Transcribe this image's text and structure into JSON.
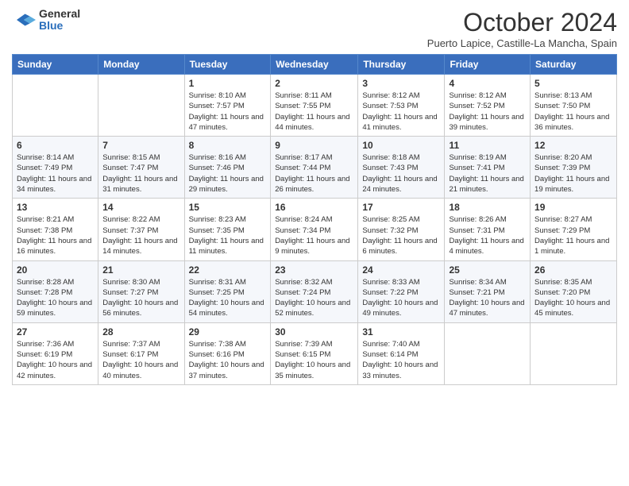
{
  "header": {
    "logo_line1": "General",
    "logo_line2": "Blue",
    "month_title": "October 2024",
    "subtitle": "Puerto Lapice, Castille-La Mancha, Spain"
  },
  "weekdays": [
    "Sunday",
    "Monday",
    "Tuesday",
    "Wednesday",
    "Thursday",
    "Friday",
    "Saturday"
  ],
  "weeks": [
    [
      {
        "day": "",
        "sunrise": "",
        "sunset": "",
        "daylight": ""
      },
      {
        "day": "",
        "sunrise": "",
        "sunset": "",
        "daylight": ""
      },
      {
        "day": "1",
        "sunrise": "Sunrise: 8:10 AM",
        "sunset": "Sunset: 7:57 PM",
        "daylight": "Daylight: 11 hours and 47 minutes."
      },
      {
        "day": "2",
        "sunrise": "Sunrise: 8:11 AM",
        "sunset": "Sunset: 7:55 PM",
        "daylight": "Daylight: 11 hours and 44 minutes."
      },
      {
        "day": "3",
        "sunrise": "Sunrise: 8:12 AM",
        "sunset": "Sunset: 7:53 PM",
        "daylight": "Daylight: 11 hours and 41 minutes."
      },
      {
        "day": "4",
        "sunrise": "Sunrise: 8:12 AM",
        "sunset": "Sunset: 7:52 PM",
        "daylight": "Daylight: 11 hours and 39 minutes."
      },
      {
        "day": "5",
        "sunrise": "Sunrise: 8:13 AM",
        "sunset": "Sunset: 7:50 PM",
        "daylight": "Daylight: 11 hours and 36 minutes."
      }
    ],
    [
      {
        "day": "6",
        "sunrise": "Sunrise: 8:14 AM",
        "sunset": "Sunset: 7:49 PM",
        "daylight": "Daylight: 11 hours and 34 minutes."
      },
      {
        "day": "7",
        "sunrise": "Sunrise: 8:15 AM",
        "sunset": "Sunset: 7:47 PM",
        "daylight": "Daylight: 11 hours and 31 minutes."
      },
      {
        "day": "8",
        "sunrise": "Sunrise: 8:16 AM",
        "sunset": "Sunset: 7:46 PM",
        "daylight": "Daylight: 11 hours and 29 minutes."
      },
      {
        "day": "9",
        "sunrise": "Sunrise: 8:17 AM",
        "sunset": "Sunset: 7:44 PM",
        "daylight": "Daylight: 11 hours and 26 minutes."
      },
      {
        "day": "10",
        "sunrise": "Sunrise: 8:18 AM",
        "sunset": "Sunset: 7:43 PM",
        "daylight": "Daylight: 11 hours and 24 minutes."
      },
      {
        "day": "11",
        "sunrise": "Sunrise: 8:19 AM",
        "sunset": "Sunset: 7:41 PM",
        "daylight": "Daylight: 11 hours and 21 minutes."
      },
      {
        "day": "12",
        "sunrise": "Sunrise: 8:20 AM",
        "sunset": "Sunset: 7:39 PM",
        "daylight": "Daylight: 11 hours and 19 minutes."
      }
    ],
    [
      {
        "day": "13",
        "sunrise": "Sunrise: 8:21 AM",
        "sunset": "Sunset: 7:38 PM",
        "daylight": "Daylight: 11 hours and 16 minutes."
      },
      {
        "day": "14",
        "sunrise": "Sunrise: 8:22 AM",
        "sunset": "Sunset: 7:37 PM",
        "daylight": "Daylight: 11 hours and 14 minutes."
      },
      {
        "day": "15",
        "sunrise": "Sunrise: 8:23 AM",
        "sunset": "Sunset: 7:35 PM",
        "daylight": "Daylight: 11 hours and 11 minutes."
      },
      {
        "day": "16",
        "sunrise": "Sunrise: 8:24 AM",
        "sunset": "Sunset: 7:34 PM",
        "daylight": "Daylight: 11 hours and 9 minutes."
      },
      {
        "day": "17",
        "sunrise": "Sunrise: 8:25 AM",
        "sunset": "Sunset: 7:32 PM",
        "daylight": "Daylight: 11 hours and 6 minutes."
      },
      {
        "day": "18",
        "sunrise": "Sunrise: 8:26 AM",
        "sunset": "Sunset: 7:31 PM",
        "daylight": "Daylight: 11 hours and 4 minutes."
      },
      {
        "day": "19",
        "sunrise": "Sunrise: 8:27 AM",
        "sunset": "Sunset: 7:29 PM",
        "daylight": "Daylight: 11 hours and 1 minute."
      }
    ],
    [
      {
        "day": "20",
        "sunrise": "Sunrise: 8:28 AM",
        "sunset": "Sunset: 7:28 PM",
        "daylight": "Daylight: 10 hours and 59 minutes."
      },
      {
        "day": "21",
        "sunrise": "Sunrise: 8:30 AM",
        "sunset": "Sunset: 7:27 PM",
        "daylight": "Daylight: 10 hours and 56 minutes."
      },
      {
        "day": "22",
        "sunrise": "Sunrise: 8:31 AM",
        "sunset": "Sunset: 7:25 PM",
        "daylight": "Daylight: 10 hours and 54 minutes."
      },
      {
        "day": "23",
        "sunrise": "Sunrise: 8:32 AM",
        "sunset": "Sunset: 7:24 PM",
        "daylight": "Daylight: 10 hours and 52 minutes."
      },
      {
        "day": "24",
        "sunrise": "Sunrise: 8:33 AM",
        "sunset": "Sunset: 7:22 PM",
        "daylight": "Daylight: 10 hours and 49 minutes."
      },
      {
        "day": "25",
        "sunrise": "Sunrise: 8:34 AM",
        "sunset": "Sunset: 7:21 PM",
        "daylight": "Daylight: 10 hours and 47 minutes."
      },
      {
        "day": "26",
        "sunrise": "Sunrise: 8:35 AM",
        "sunset": "Sunset: 7:20 PM",
        "daylight": "Daylight: 10 hours and 45 minutes."
      }
    ],
    [
      {
        "day": "27",
        "sunrise": "Sunrise: 7:36 AM",
        "sunset": "Sunset: 6:19 PM",
        "daylight": "Daylight: 10 hours and 42 minutes."
      },
      {
        "day": "28",
        "sunrise": "Sunrise: 7:37 AM",
        "sunset": "Sunset: 6:17 PM",
        "daylight": "Daylight: 10 hours and 40 minutes."
      },
      {
        "day": "29",
        "sunrise": "Sunrise: 7:38 AM",
        "sunset": "Sunset: 6:16 PM",
        "daylight": "Daylight: 10 hours and 37 minutes."
      },
      {
        "day": "30",
        "sunrise": "Sunrise: 7:39 AM",
        "sunset": "Sunset: 6:15 PM",
        "daylight": "Daylight: 10 hours and 35 minutes."
      },
      {
        "day": "31",
        "sunrise": "Sunrise: 7:40 AM",
        "sunset": "Sunset: 6:14 PM",
        "daylight": "Daylight: 10 hours and 33 minutes."
      },
      {
        "day": "",
        "sunrise": "",
        "sunset": "",
        "daylight": ""
      },
      {
        "day": "",
        "sunrise": "",
        "sunset": "",
        "daylight": ""
      }
    ]
  ]
}
